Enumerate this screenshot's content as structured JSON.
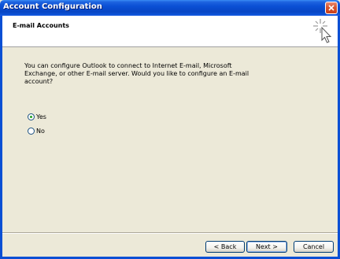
{
  "window": {
    "title": "Account Configuration",
    "close_icon": "close-icon"
  },
  "header": {
    "title": "E-mail Accounts",
    "icon": "wizard-sparkle-cursor-icon"
  },
  "main": {
    "message": "You can configure Outlook to connect to Internet E-mail, Microsoft Exchange, or other E-mail server. Would you like to configure an E-mail account?",
    "options": [
      {
        "label": "Yes",
        "selected": true
      },
      {
        "label": "No",
        "selected": false
      }
    ]
  },
  "footer": {
    "back_label": "< Back",
    "next_label": "Next >",
    "cancel_label": "Cancel"
  },
  "colors": {
    "titlebar": "#0A4FD4",
    "dialog_bg": "#ECE9D8",
    "close": "#D9552E"
  }
}
